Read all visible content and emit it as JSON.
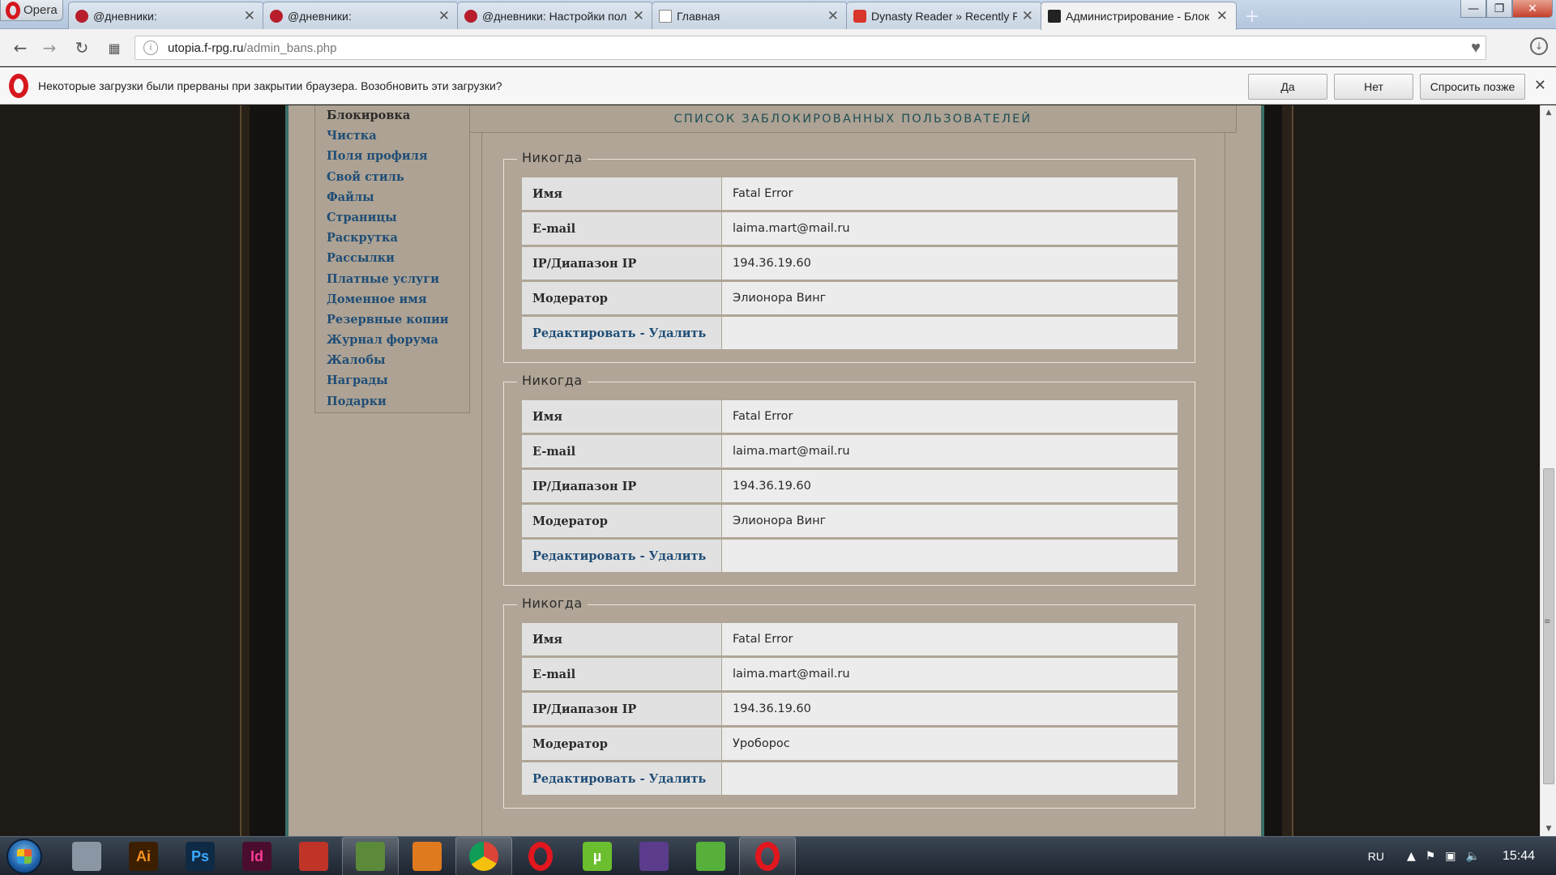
{
  "browser": {
    "menu_label": "Opera",
    "tabs": [
      {
        "title": "@дневники:",
        "icon": "diary-favicon"
      },
      {
        "title": "@дневники:",
        "icon": "diary-favicon"
      },
      {
        "title": "@дневники: Настройки пол",
        "icon": "diary-favicon"
      },
      {
        "title": "Главная",
        "icon": "document-favicon"
      },
      {
        "title": "Dynasty Reader » Recently R",
        "icon": "dynasty-favicon"
      },
      {
        "title": "Администрирование - Блок",
        "icon": "admin-favicon",
        "active": true
      }
    ],
    "url_host": "utopia.f-rpg.ru",
    "url_path": "/admin_bans.php"
  },
  "notification": {
    "text": "Некоторые загрузки были прерваны при закрытии браузера. Возобновить эти загрузки?",
    "yes_label": "Да",
    "no_label": "Нет",
    "later_label": "Спросить позже"
  },
  "sidebar": {
    "items": [
      {
        "label": "Блокировка",
        "current": true
      },
      {
        "label": "Чистка"
      },
      {
        "label": "Поля профиля"
      },
      {
        "label": "Свой стиль"
      },
      {
        "label": "Файлы"
      },
      {
        "label": "Страницы"
      },
      {
        "label": "Раскрутка"
      },
      {
        "label": "Рассылки"
      },
      {
        "label": "Платные услуги"
      },
      {
        "label": "Доменное имя"
      },
      {
        "label": "Резервные копии"
      },
      {
        "label": "Журнал форума"
      },
      {
        "label": "Жалобы"
      },
      {
        "label": "Награды"
      },
      {
        "label": "Подарки"
      }
    ]
  },
  "main": {
    "title": "Список заблокированных пользователей",
    "field_labels": {
      "name": "Имя",
      "email": "E-mail",
      "ip": "IP/Диапазон IP",
      "moderator": "Модератор"
    },
    "edit_label": "Редактировать",
    "separator": " - ",
    "delete_label": "Удалить",
    "bans": [
      {
        "expires": "Никогда",
        "name": "Fatal Error",
        "email": "laima.mart@mail.ru",
        "ip": "194.36.19.60",
        "moderator": "Элионора Винг"
      },
      {
        "expires": "Никогда",
        "name": "Fatal Error",
        "email": "laima.mart@mail.ru",
        "ip": "194.36.19.60",
        "moderator": "Элионора Винг"
      },
      {
        "expires": "Никогда",
        "name": "Fatal Error",
        "email": "laima.mart@mail.ru",
        "ip": "194.36.19.60",
        "moderator": "Уроборос"
      }
    ]
  },
  "taskbar": {
    "apps": [
      {
        "name": "printer-app",
        "glyph": "",
        "bg": "#8a96a3",
        "fg": "#fff"
      },
      {
        "name": "illustrator-app",
        "glyph": "Ai",
        "bg": "#3b1f00",
        "fg": "#f7931e"
      },
      {
        "name": "photoshop-app",
        "glyph": "Ps",
        "bg": "#0f2a44",
        "fg": "#39a9ff"
      },
      {
        "name": "indesign-app",
        "glyph": "Id",
        "bg": "#4a0d2d",
        "fg": "#ff3b95"
      },
      {
        "name": "ccleaner-app",
        "glyph": "",
        "bg": "#c03428",
        "fg": "#fff"
      },
      {
        "name": "recycle-app",
        "glyph": "",
        "bg": "#5a8a3a",
        "fg": "#fff",
        "open": true
      },
      {
        "name": "viewer-app",
        "glyph": "",
        "bg": "#e07a1f",
        "fg": "#fff"
      },
      {
        "name": "chrome-app",
        "glyph": "",
        "bg": "#3a8a3a",
        "fg": "#fff",
        "open": true
      },
      {
        "name": "opera-app",
        "glyph": "",
        "bg": "transparent",
        "fg": "#e2161e"
      },
      {
        "name": "utorrent-app",
        "glyph": "µ",
        "bg": "#6bbf2f",
        "fg": "#fff"
      },
      {
        "name": "visual-studio-app",
        "glyph": "",
        "bg": "#5b3c8c",
        "fg": "#fff"
      },
      {
        "name": "icq-app",
        "glyph": "",
        "bg": "#56b03a",
        "fg": "#fff"
      },
      {
        "name": "opera-app-2",
        "glyph": "",
        "bg": "transparent",
        "fg": "#e2161e",
        "open": true
      }
    ],
    "lang": "RU",
    "clock": "15:44"
  }
}
